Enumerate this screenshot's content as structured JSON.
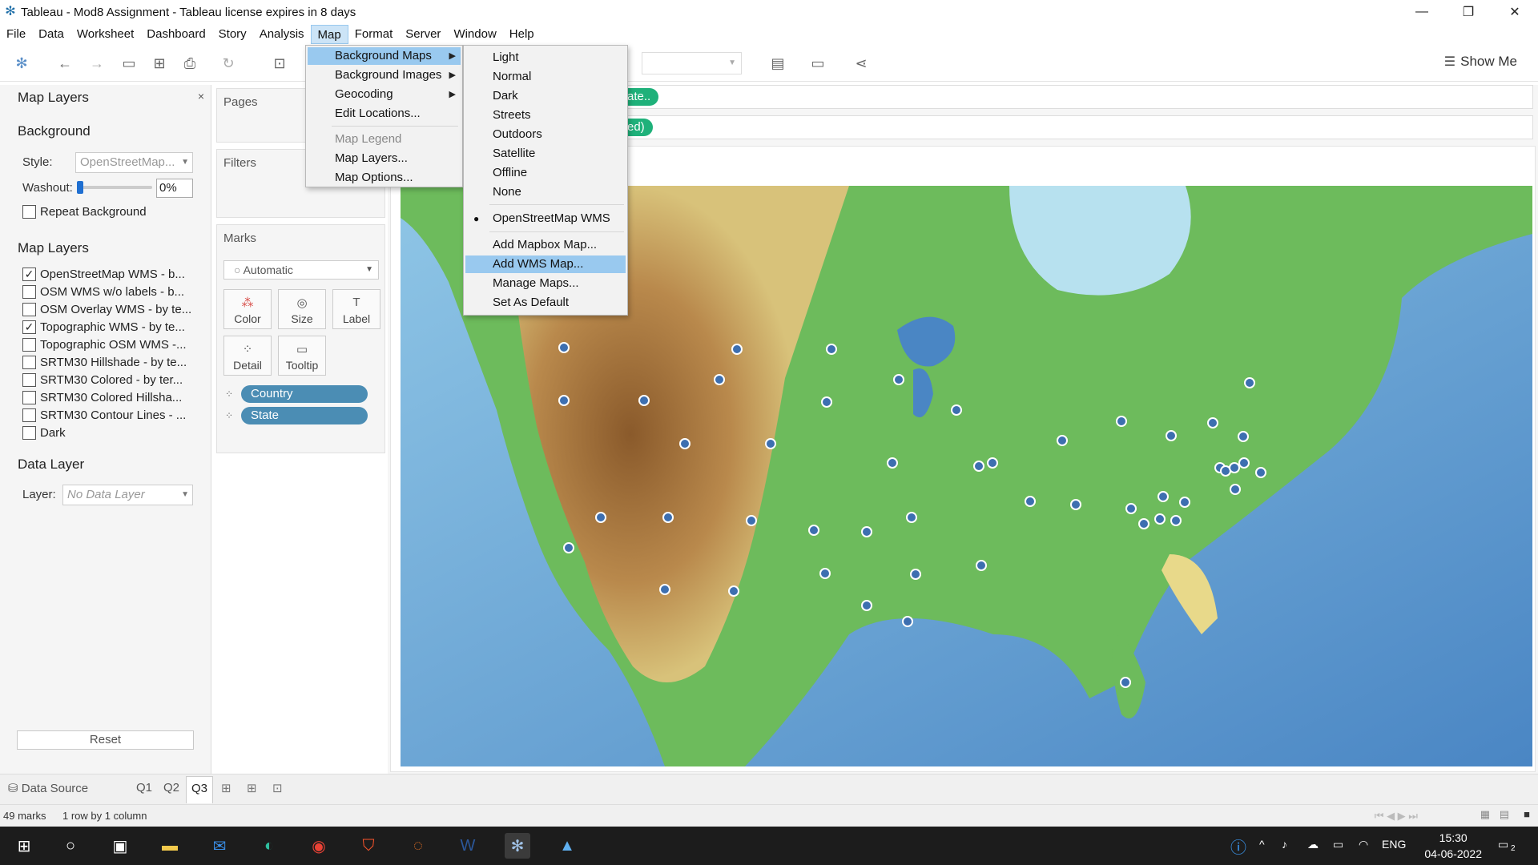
{
  "window": {
    "title": "Tableau - Mod8 Assignment - Tableau license expires in 8 days",
    "controls": [
      "—",
      "❐",
      "✕"
    ]
  },
  "menubar": [
    "File",
    "Data",
    "Worksheet",
    "Dashboard",
    "Story",
    "Analysis",
    "Map",
    "Format",
    "Server",
    "Window",
    "Help"
  ],
  "toolbar": {
    "show_me_label": "Show Me"
  },
  "map_layers_pane": {
    "title": "Map Layers",
    "close": "×",
    "background_title": "Background",
    "style_label": "Style:",
    "style_value": "OpenStreetMap...",
    "washout_label": "Washout:",
    "washout_value": "0%",
    "washout_level": 0,
    "repeat_background": "Repeat Background",
    "map_layers_title": "Map Layers",
    "layers": [
      {
        "label": "OpenStreetMap WMS - b...",
        "checked": true
      },
      {
        "label": "OSM WMS w/o labels - b...",
        "checked": false
      },
      {
        "label": "OSM Overlay WMS - by te...",
        "checked": false
      },
      {
        "label": "Topographic WMS - by te...",
        "checked": true
      },
      {
        "label": "Topographic OSM WMS -...",
        "checked": false
      },
      {
        "label": "SRTM30 Hillshade - by te...",
        "checked": false
      },
      {
        "label": "SRTM30 Colored - by ter...",
        "checked": false
      },
      {
        "label": "SRTM30 Colored Hillsha...",
        "checked": false
      },
      {
        "label": "SRTM30 Contour Lines - ...",
        "checked": false
      },
      {
        "label": "Dark",
        "checked": false
      }
    ],
    "data_layer_title": "Data Layer",
    "layer_label": "Layer:",
    "layer_value": "No Data Layer",
    "reset": "Reset"
  },
  "cards": {
    "pages": "Pages",
    "filters": "Filters",
    "marks": "Marks",
    "mark_type": "Automatic",
    "mark_buttons": [
      "Color",
      "Size",
      "Label",
      "Detail",
      "Tooltip"
    ],
    "pills": [
      "Country",
      "State"
    ]
  },
  "shelves": {
    "columns_pill": "ate..",
    "rows_pill": "ed)"
  },
  "map_menu": {
    "items": [
      {
        "label": "Background Maps",
        "submenu": true,
        "highlighted": true
      },
      {
        "label": "Background Images",
        "submenu": true
      },
      {
        "label": "Geocoding",
        "submenu": true
      },
      {
        "label": "Edit Locations..."
      },
      {
        "label": "Map Legend",
        "disabled": true
      },
      {
        "label": "Map Layers..."
      },
      {
        "label": "Map Options..."
      }
    ]
  },
  "background_maps_menu": {
    "items": [
      {
        "label": "Light"
      },
      {
        "label": "Normal"
      },
      {
        "label": "Dark"
      },
      {
        "label": "Streets"
      },
      {
        "label": "Outdoors"
      },
      {
        "label": "Satellite"
      },
      {
        "label": "Offline"
      },
      {
        "label": "None"
      },
      {
        "label": "OpenStreetMap WMS",
        "selected": true
      },
      {
        "label": "Add Mapbox Map..."
      },
      {
        "label": "Add WMS Map...",
        "highlighted": true
      },
      {
        "label": "Manage Maps..."
      },
      {
        "label": "Set As Default"
      }
    ]
  },
  "tabs": {
    "data_source": "Data Source",
    "sheets": [
      "Q1",
      "Q2",
      "Q3"
    ],
    "active": "Q3"
  },
  "status": {
    "marks": "49 marks",
    "dims": "1 row by 1 column"
  },
  "taskbar": {
    "lang": "ENG",
    "time": "15:30",
    "date": "04-06-2022",
    "notif_count": "2"
  },
  "colors": {
    "pill_blue": "#4b8db4",
    "pill_green": "#1fb17a",
    "menu_highlight": "#99c9ef",
    "mark": "#3d6fb0"
  },
  "map_marks_count": 49
}
